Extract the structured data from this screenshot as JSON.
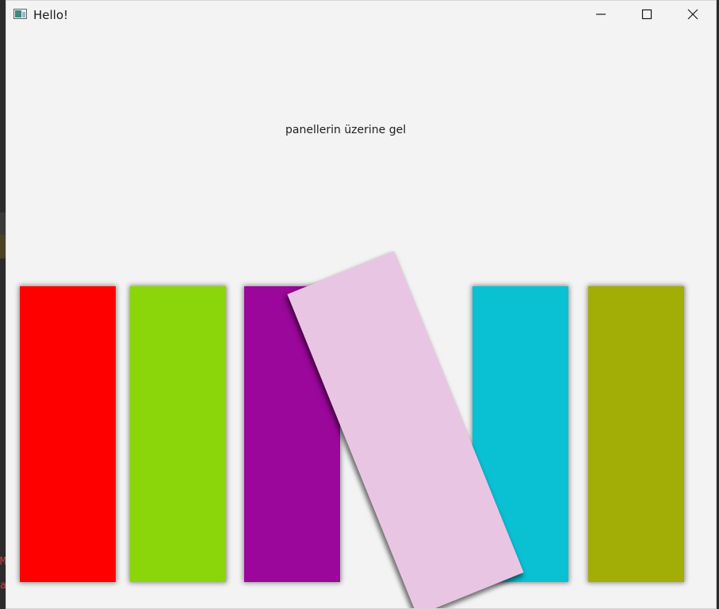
{
  "window": {
    "title": "Hello!",
    "controls": {
      "minimize": "minimize-icon",
      "maximize": "maximize-icon",
      "close": "close-icon"
    }
  },
  "content": {
    "hint_text": "panellerin üzerine gel",
    "panels": [
      {
        "name": "panel-red",
        "color": "#ff0000"
      },
      {
        "name": "panel-green",
        "color": "#8ad60b"
      },
      {
        "name": "panel-purple",
        "color": "#9a079a"
      },
      {
        "name": "panel-pink",
        "color": "#e8c6e3",
        "state": "tilted"
      },
      {
        "name": "panel-cyan",
        "color": "#0ac1d3"
      },
      {
        "name": "panel-olive",
        "color": "#a2ad05"
      }
    ]
  },
  "background_editor": {
    "visible_chars": [
      "M",
      "a"
    ]
  }
}
